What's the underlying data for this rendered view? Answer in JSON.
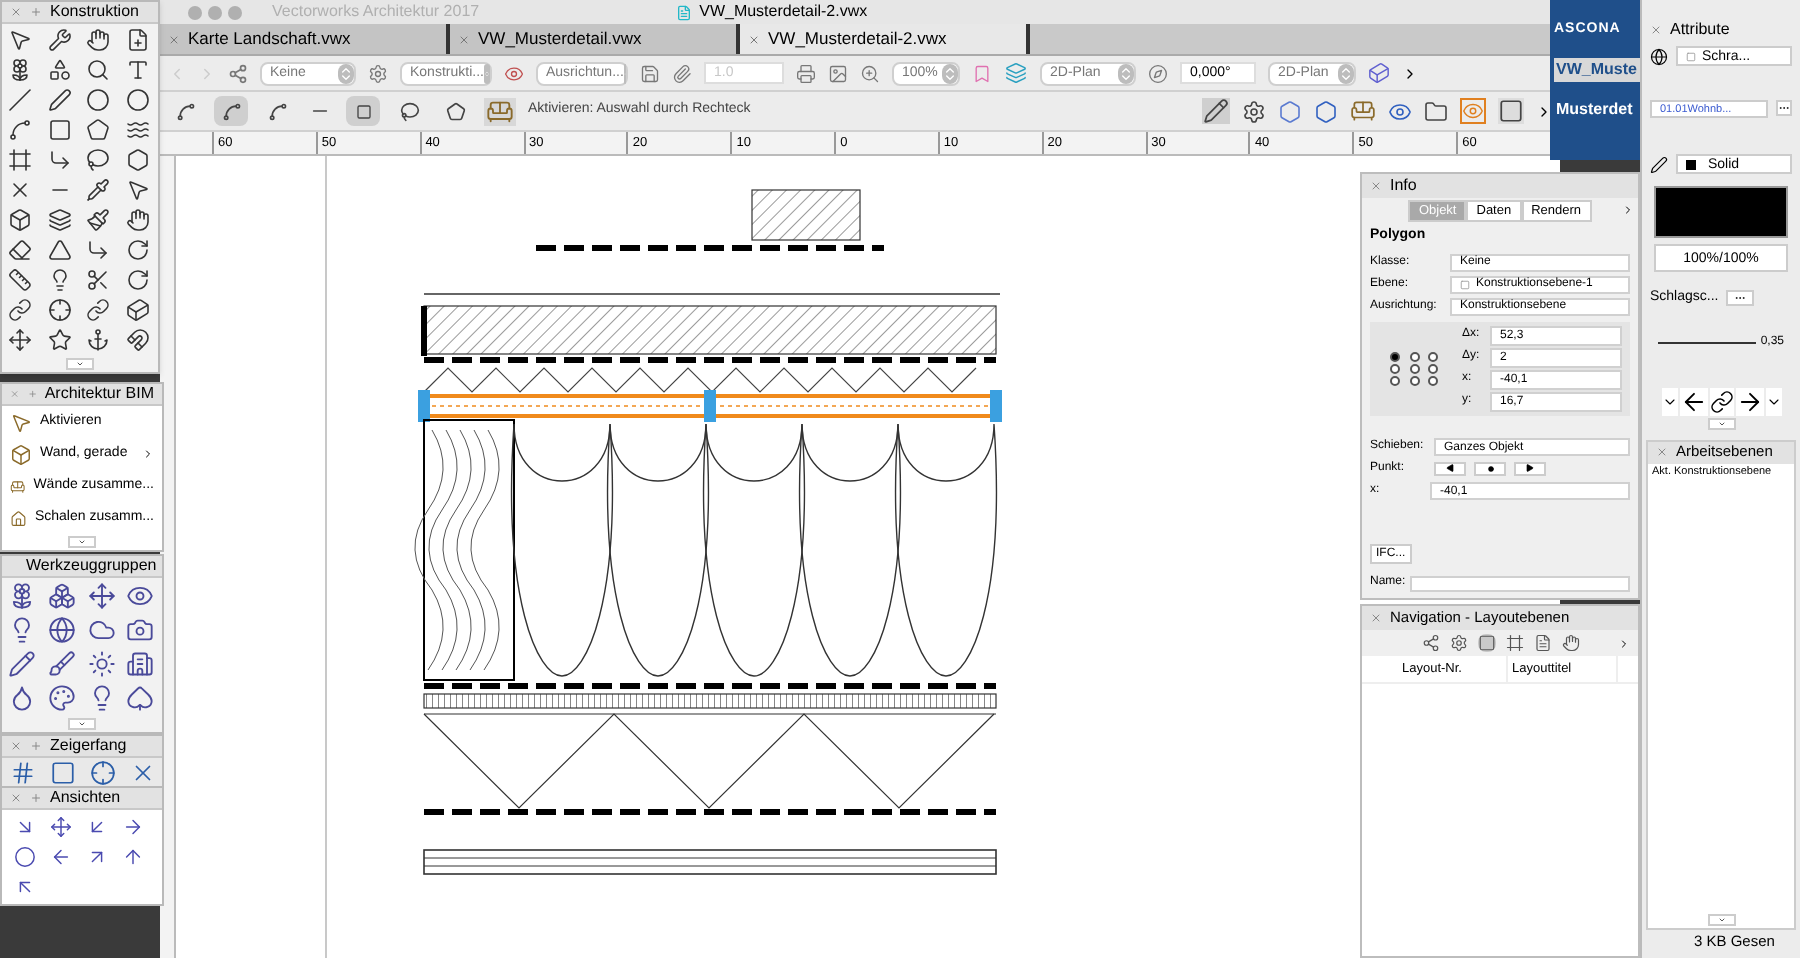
{
  "app": {
    "title": "Vectorworks Architektur 2017",
    "document": "VW_Musterdetail-2.vwx"
  },
  "tabs": [
    {
      "label": "Karte Landschaft.vwx",
      "selected": false
    },
    {
      "label": "VW_Musterdetail.vwx",
      "selected": false
    },
    {
      "label": "VW_Musterdetail-2.vwx",
      "selected": true
    }
  ],
  "view_bar": {
    "class": "Keine",
    "layer": "Konstrukti...",
    "plane": "Ausrichtun...",
    "line_weight": {
      "value": "1.0",
      "disabled": true
    },
    "zoom": "100%",
    "view": "2D-Plan",
    "angle": "0,000°",
    "render": "2D-Plan"
  },
  "mode_bar": {
    "snap_modes": [
      {
        "selected": false
      },
      {
        "selected": true
      },
      {
        "selected": false
      }
    ],
    "selection_shapes": [
      {
        "selected": true
      },
      {
        "selected": false
      },
      {
        "selected": false
      }
    ],
    "hint": "Aktivieren: Auswahl durch Rechteck"
  },
  "ruler": {
    "ticks": [
      "60",
      "50",
      "40",
      "30",
      "20",
      "10",
      "0",
      "10",
      "20",
      "30",
      "40",
      "50",
      "60"
    ]
  },
  "background_window": {
    "title": "ASCONA",
    "items": [
      {
        "label": "VW_Muste",
        "selected": true
      },
      {
        "label": "Musterdet",
        "selected": false
      }
    ]
  },
  "konstruktion": {
    "title": "Konstruktion"
  },
  "architektur_bim": {
    "title": "Architektur BIM",
    "items": [
      {
        "label": "Aktivieren",
        "submenu": false
      },
      {
        "label": "Wand, gerade",
        "submenu": true
      },
      {
        "label": "Wände zusamme...",
        "submenu": false
      },
      {
        "label": "Schalen zusamm...",
        "submenu": false
      }
    ]
  },
  "werkzeuggruppen": {
    "title": "Werkzeuggruppen"
  },
  "zeigerfang": {
    "title": "Zeigerfang"
  },
  "ansichten": {
    "title": "Ansichten"
  },
  "info": {
    "title": "Info",
    "tabs": [
      {
        "label": "Objekt",
        "selected": true
      },
      {
        "label": "Daten",
        "selected": false
      },
      {
        "label": "Rendern",
        "selected": false
      }
    ],
    "object_type": "Polygon",
    "fields": [
      {
        "label": "Klasse:",
        "value": "Keine"
      },
      {
        "label": "Ebene:",
        "value": "Konstruktionsebene-1"
      },
      {
        "label": "Ausrichtung:",
        "value": "Konstruktionsebene"
      }
    ],
    "reference_points": [
      {
        "selected": true
      },
      {
        "selected": false
      },
      {
        "selected": false
      },
      {
        "selected": false
      },
      {
        "selected": false
      },
      {
        "selected": false
      },
      {
        "selected": false
      },
      {
        "selected": false
      },
      {
        "selected": false
      }
    ],
    "geometry": [
      {
        "label": "Δx:",
        "value": "52,3"
      },
      {
        "label": "Δy:",
        "value": "2"
      },
      {
        "label": "x:",
        "value": "-40,1"
      },
      {
        "label": "y:",
        "value": "16,7"
      }
    ],
    "shift": {
      "label": "Schieben:",
      "value": "Ganzes Objekt"
    },
    "point_label": "Punkt:",
    "point_x": {
      "label": "x:",
      "value": "-40,1"
    },
    "ifc_button": "IFC...",
    "name_label": "Name:"
  },
  "navigation": {
    "title": "Navigation - Layoutebenen",
    "columns": [
      "Layout-Nr.",
      "Layouttitel"
    ]
  },
  "attribute": {
    "title": "Attribute",
    "fill": "Schra...",
    "hatch": "01.01Wohnb...",
    "pen": "Solid",
    "opacity": "100%/100%",
    "shadow": "Schlagsc...",
    "line_thickness": "0,35"
  },
  "arbeitsebenen": {
    "title": "Arbeitsebenen",
    "items": [
      "Akt. Konstruktionsebene"
    ]
  },
  "status": "3 KB  Gesen"
}
